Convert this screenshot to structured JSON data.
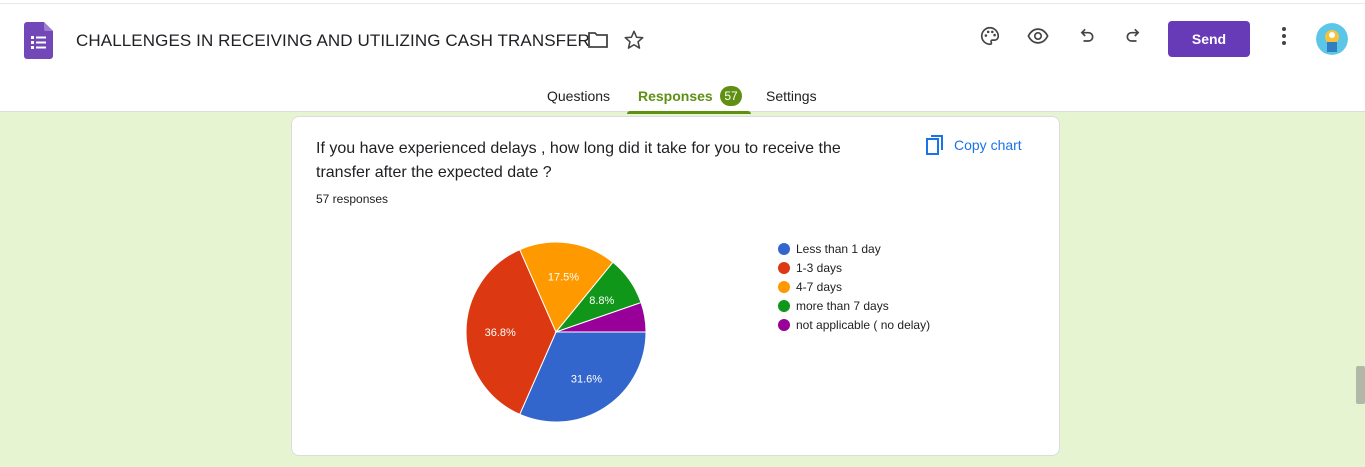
{
  "header": {
    "title": "CHALLENGES IN RECEIVING AND UTILIZING CASH TRANSFER",
    "send_label": "Send",
    "icons": [
      "forms-app-icon",
      "folder-icon",
      "star-icon",
      "palette-icon",
      "eye-icon",
      "undo-icon",
      "redo-icon",
      "more-vert-icon"
    ]
  },
  "tabs": [
    {
      "label": "Questions"
    },
    {
      "label": "Responses",
      "count": "57",
      "active": true
    },
    {
      "label": "Settings"
    }
  ],
  "card": {
    "question": "If you have experienced delays , how long did it take for you to receive the transfer after the expected date ?",
    "responses_label": "57 responses",
    "copy_chart_label": "Copy chart"
  },
  "colors": {
    "brand_purple": "#673ab7",
    "accent_green": "#5f8f13",
    "background": "#e6f4d2",
    "link_blue": "#1a73e8"
  },
  "chart_data": {
    "type": "pie",
    "labels": [
      "Less than 1 day",
      "1-3 days",
      "4-7 days",
      "more than 7 days",
      "not applicable ( no delay)"
    ],
    "values": [
      31.6,
      36.8,
      17.5,
      8.8,
      5.3
    ],
    "data_labels": [
      "31.6%",
      "36.8%",
      "17.5%",
      "8.8%",
      ""
    ],
    "colors": [
      "#3366cc",
      "#dc3912",
      "#ff9900",
      "#109618",
      "#990099"
    ],
    "legend_position": "right"
  }
}
